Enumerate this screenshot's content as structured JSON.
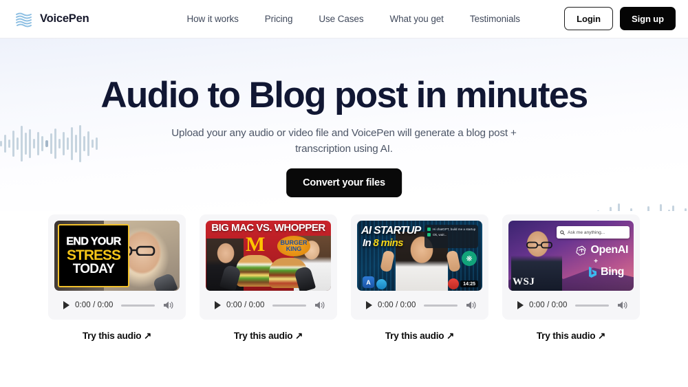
{
  "brand": {
    "name": "VoicePen",
    "logo_icon": "wave-lines-logo-icon"
  },
  "nav": {
    "links": [
      {
        "label": "How it works"
      },
      {
        "label": "Pricing"
      },
      {
        "label": "Use Cases"
      },
      {
        "label": "What you get"
      },
      {
        "label": "Testimonials"
      }
    ],
    "login_label": "Login",
    "signup_label": "Sign up"
  },
  "hero": {
    "title": "Audio to Blog post in minutes",
    "subtitle": "Upload your any audio or video file and VoicePen will generate a blog post + transcription using AI.",
    "cta_label": "Convert your files",
    "decor_left_icon": "audio-waveform-icon",
    "decor_right_icon": "audio-waveform-icon"
  },
  "colors": {
    "accent_dark": "#050505",
    "heading": "#111733",
    "body_text": "#4c5566",
    "card_bg": "#f6f6f8",
    "waveform": "#c6d2e0"
  },
  "player": {
    "play_icon": "play-icon",
    "time": "0:00 / 0:00",
    "volume_icon": "volume-icon"
  },
  "cards": [
    {
      "try_label": "Try this audio ↗",
      "thumb": {
        "id": "end-your-stress-today",
        "line1": "END YOUR",
        "line2": "STRESS",
        "line3": "TODAY"
      }
    },
    {
      "try_label": "Try this audio ↗",
      "thumb": {
        "id": "big-mac-vs-whopper",
        "headline": "BIG MAC VS. WHOPPER",
        "brand_left": "M",
        "brand_right": "BURGER KING"
      }
    },
    {
      "try_label": "Try this audio ↗",
      "thumb": {
        "id": "ai-startup-in-8-mins",
        "line1": "AI STARTUP",
        "line2_prefix": "In ",
        "line2_highlight": "8 mins",
        "chat1": "Hi chatGPT, build me a startup",
        "chat2": "Ok, wait...",
        "timestamp": "14:25"
      }
    },
    {
      "try_label": "Try this audio ↗",
      "thumb": {
        "id": "openai-plus-bing-wsj",
        "search_placeholder": "Ask me anything...",
        "label_openai": "OpenAI",
        "plus": "+",
        "label_bing": "Bing",
        "publisher": "WSJ"
      }
    }
  ]
}
